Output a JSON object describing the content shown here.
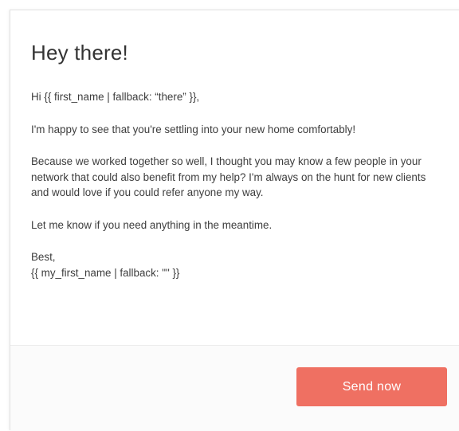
{
  "email": {
    "greeting": "Hey there!",
    "salutation": "Hi {{ first_name | fallback: “there” }},",
    "paragraph_1": "I'm happy to see that you're settling into your new home comfortably!",
    "paragraph_2": "Because we worked together so well, I thought you may know a few people in your network that could also benefit from my help? I'm always on the hunt for new clients and would love if you could refer anyone my way.",
    "paragraph_3": "Let me know if you need anything in the meantime.",
    "signoff": "Best,",
    "signature": "{{ my_first_name | fallback: \"\" }}"
  },
  "footer": {
    "send_label": "Send now"
  },
  "colors": {
    "button_background": "#ef7062",
    "button_text": "#ffffff",
    "text": "#3d3d3d"
  }
}
